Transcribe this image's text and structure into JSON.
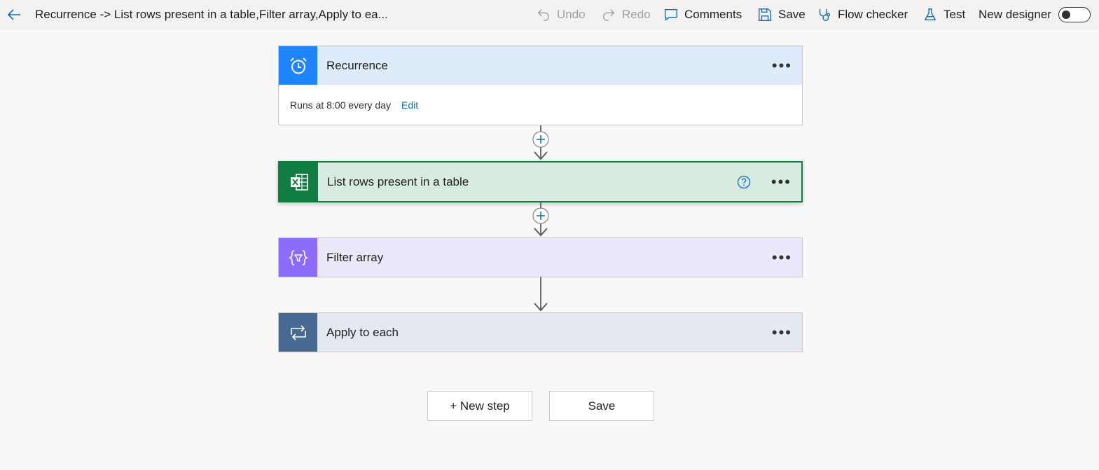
{
  "toolbar": {
    "title": "Recurrence -> List rows present in a table,Filter array,Apply to ea...",
    "undo": "Undo",
    "redo": "Redo",
    "comments": "Comments",
    "save": "Save",
    "flow_checker": "Flow checker",
    "test": "Test",
    "new_designer": "New designer",
    "new_designer_enabled": false
  },
  "steps": [
    {
      "title": "Recurrence",
      "icon": "alarm-clock-icon",
      "color": "#1f85ff",
      "header_bg": "#deebfb",
      "body_text": "Runs at 8:00 every day",
      "body_link": "Edit"
    },
    {
      "title": "List rows present in a table",
      "icon": "excel-icon",
      "color": "#107c41",
      "header_bg": "#d8ebe1",
      "selected": true
    },
    {
      "title": "Filter array",
      "icon": "filter-braces-icon",
      "color": "#8c6cff",
      "header_bg": "#ece8fc"
    },
    {
      "title": "Apply to each",
      "icon": "loop-icon",
      "color": "#486991",
      "header_bg": "#e4e8f0"
    }
  ],
  "buttons": {
    "new_step": "+ New step",
    "save": "Save"
  }
}
